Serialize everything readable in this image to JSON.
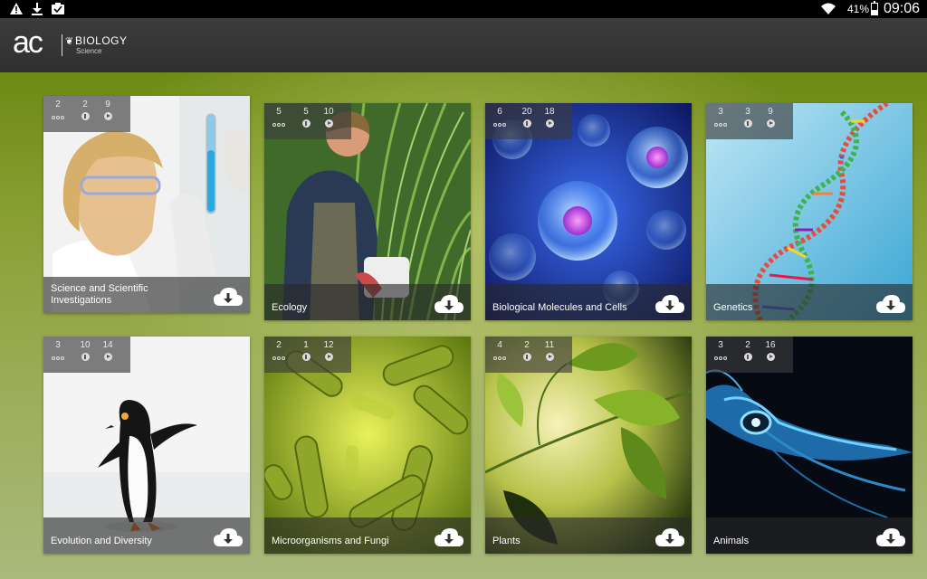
{
  "status_bar": {
    "icons": [
      "warning-icon",
      "download-icon",
      "clipboard-check-icon"
    ],
    "wifi": "wifi-icon",
    "battery_percent": "41%",
    "battery_level": 0.41,
    "time": "09:06"
  },
  "app": {
    "logo": "ac",
    "subject": "BIOLOGY",
    "sub": "Science"
  },
  "tiles": [
    {
      "title": "Science and Scientific Investigations",
      "stats": [
        "2",
        "2",
        "9"
      ],
      "art": "scientist"
    },
    {
      "title": "Ecology",
      "stats": [
        "5",
        "5",
        "10"
      ],
      "art": "ecology"
    },
    {
      "title": "Biological Molecules and Cells",
      "stats": [
        "6",
        "20",
        "18"
      ],
      "art": "cells"
    },
    {
      "title": "Genetics",
      "stats": [
        "3",
        "3",
        "9"
      ],
      "art": "dna"
    },
    {
      "title": "Evolution and  Diversity",
      "stats": [
        "3",
        "10",
        "14"
      ],
      "art": "penguin"
    },
    {
      "title": "Microorganisms and Fungi",
      "stats": [
        "2",
        "1",
        "12"
      ],
      "art": "bacteria"
    },
    {
      "title": "Plants",
      "stats": [
        "4",
        "2",
        "11"
      ],
      "art": "plants"
    },
    {
      "title": "Animals",
      "stats": [
        "3",
        "2",
        "16"
      ],
      "art": "squid"
    }
  ],
  "colors": {
    "statusbar": "#000000",
    "actionbar": "#353535",
    "background": "#8aa034",
    "caption": "#2b2b2b"
  }
}
